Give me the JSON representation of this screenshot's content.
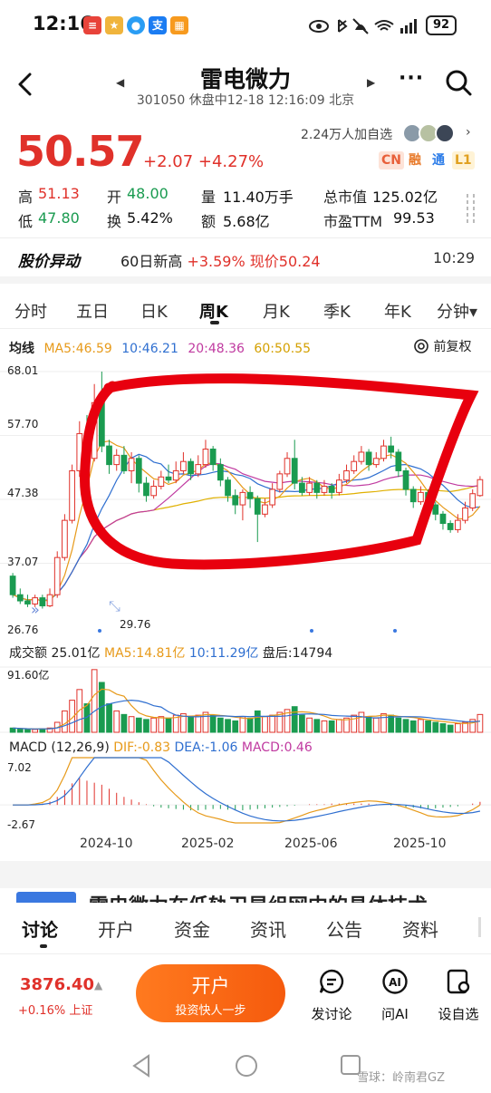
{
  "status": {
    "time": "12:16",
    "battery": "92",
    "colors": {
      "red": "#e8433a",
      "orange": "#f79a1e",
      "blue": "#1b7cf2"
    }
  },
  "header": {
    "stock_name": "雷电微力",
    "subtitle": "301050 休盘中12-18 12:16:09 北京"
  },
  "quote": {
    "price": "50.57",
    "change": "+2.07 +4.27%",
    "followers": "2.24万人加自选",
    "tags": [
      "CN",
      "融",
      "通",
      "L1"
    ],
    "stats": [
      {
        "label": "高",
        "value": "51.13",
        "color": "#e0312a"
      },
      {
        "label": "开",
        "value": "48.00",
        "color": "#1a9b50"
      },
      {
        "label": "量",
        "value": "11.40万手",
        "color": "#222"
      },
      {
        "label": "总市值",
        "value": "125.02亿",
        "color": "#222"
      },
      {
        "label": "低",
        "value": "47.80",
        "color": "#1a9b50"
      },
      {
        "label": "换",
        "value": "5.42%",
        "color": "#222"
      },
      {
        "label": "额",
        "value": "5.68亿",
        "color": "#222"
      },
      {
        "label": "市盈TTM",
        "value": "99.53",
        "color": "#222"
      }
    ]
  },
  "alert": {
    "title": "股价异动",
    "text_prefix": "60日新高 ",
    "text_highlight": "+3.59%",
    "text_suffix": " 现价50.24",
    "time": "10:29"
  },
  "period_tabs": [
    "分时",
    "五日",
    "日K",
    "周K",
    "月K",
    "季K",
    "年K",
    "分钟▾"
  ],
  "active_period": "周K",
  "ma": {
    "title": "均线",
    "ma5": "MA5:46.59",
    "ma10": "10:46.21",
    "ma20": "20:48.36",
    "ma60": "60:50.55",
    "adjust": "前复权"
  },
  "price_axis": [
    "68.01",
    "57.70",
    "47.38",
    "37.07",
    "26.76"
  ],
  "min_marker": "29.76",
  "volume": {
    "title": "成交额",
    "value": "25.01亿",
    "ma5": "MA5:14.81亿",
    "ma10": "10:11.29亿",
    "extra": "盘后:14794",
    "axis_max": "91.60亿"
  },
  "macd": {
    "title": "MACD",
    "params": "(12,26,9)",
    "dif": "DIF:-0.83",
    "dea": "DEA:-1.06",
    "macd": "MACD:0.46",
    "axis_max": "7.02",
    "axis_min": "-2.67"
  },
  "x_dates": [
    "2024-10",
    "2025-02",
    "2025-06",
    "2025-10"
  ],
  "news_peek": "雷电微力在低轨卫星组网中的具体技术",
  "bottom_tabs": [
    "讨论",
    "开户",
    "资金",
    "资讯",
    "公告",
    "资料"
  ],
  "footer": {
    "index_value": "3876.40",
    "index_change": "+0.16% 上证",
    "open_main": "开户",
    "open_sub": "投资快人一步",
    "buttons": [
      "发讨论",
      "问AI",
      "设自选"
    ]
  },
  "watermark": "雪球：岭南君GZ",
  "chart_data": {
    "type": "candlestick",
    "period": "weekly",
    "x_labels": [
      "2024-10",
      "2025-02",
      "2025-06",
      "2025-10"
    ],
    "ylim": [
      26.76,
      68.01
    ],
    "candles": [
      [
        35.0,
        32.0,
        35.5,
        31.5
      ],
      [
        32.0,
        31.0,
        33.0,
        30.5
      ],
      [
        31.0,
        30.5,
        32.0,
        30.0
      ],
      [
        30.5,
        31.5,
        32.0,
        30.0
      ],
      [
        31.5,
        30.2,
        32.0,
        29.76
      ],
      [
        30.2,
        32.0,
        33.0,
        30.0
      ],
      [
        32.0,
        38.0,
        39.0,
        31.5
      ],
      [
        38.0,
        44.0,
        45.0,
        37.5
      ],
      [
        44.0,
        52.0,
        53.0,
        43.5
      ],
      [
        52.0,
        58.0,
        60.0,
        51.0
      ],
      [
        58.0,
        54.0,
        61.0,
        53.0
      ],
      [
        54.0,
        63.0,
        66.0,
        53.5
      ],
      [
        63.0,
        56.0,
        68.01,
        55.0
      ],
      [
        56.0,
        53.0,
        57.0,
        51.5
      ],
      [
        53.0,
        54.5,
        55.5,
        52.0
      ],
      [
        54.5,
        52.0,
        56.0,
        51.5
      ],
      [
        52.0,
        54.0,
        55.0,
        50.0
      ],
      [
        54.0,
        50.0,
        54.5,
        48.5
      ],
      [
        50.0,
        48.0,
        51.0,
        47.0
      ],
      [
        48.0,
        49.5,
        50.5,
        47.5
      ],
      [
        49.5,
        51.0,
        52.0,
        49.0
      ],
      [
        51.0,
        50.5,
        53.0,
        50.0
      ],
      [
        50.5,
        52.0,
        53.5,
        50.0
      ],
      [
        52.0,
        53.5,
        55.0,
        51.5
      ],
      [
        53.5,
        51.5,
        54.0,
        50.5
      ],
      [
        51.5,
        53.0,
        54.5,
        51.0
      ],
      [
        53.0,
        55.5,
        57.0,
        52.5
      ],
      [
        55.5,
        53.0,
        56.0,
        52.0
      ],
      [
        53.0,
        50.5,
        54.0,
        49.5
      ],
      [
        50.5,
        48.0,
        51.0,
        47.0
      ],
      [
        48.0,
        46.5,
        49.0,
        45.0
      ],
      [
        46.5,
        48.5,
        49.0,
        44.0
      ],
      [
        48.5,
        47.5,
        49.5,
        46.0
      ],
      [
        47.5,
        45.0,
        48.0,
        40.5
      ],
      [
        45.0,
        46.5,
        47.5,
        44.5
      ],
      [
        46.5,
        49.0,
        50.0,
        46.0
      ],
      [
        49.0,
        51.5,
        52.0,
        48.5
      ],
      [
        51.5,
        54.0,
        55.0,
        51.0
      ],
      [
        54.0,
        50.0,
        57.0,
        49.0
      ],
      [
        50.0,
        48.5,
        51.0,
        48.0
      ],
      [
        48.5,
        50.0,
        51.0,
        48.0
      ],
      [
        50.0,
        48.5,
        50.5,
        47.5
      ],
      [
        48.5,
        49.5,
        50.5,
        48.0
      ],
      [
        49.5,
        48.5,
        50.0,
        47.5
      ],
      [
        48.5,
        50.5,
        51.5,
        48.0
      ],
      [
        50.5,
        52.0,
        53.0,
        50.0
      ],
      [
        52.0,
        53.5,
        54.5,
        51.5
      ],
      [
        53.5,
        55.0,
        56.0,
        53.0
      ],
      [
        55.0,
        53.0,
        55.5,
        52.0
      ],
      [
        53.0,
        54.0,
        55.0,
        52.5
      ],
      [
        54.0,
        56.0,
        57.0,
        53.5
      ],
      [
        56.0,
        55.0,
        57.5,
        54.0
      ],
      [
        55.0,
        52.0,
        55.5,
        51.0
      ],
      [
        52.0,
        49.0,
        52.5,
        48.0
      ],
      [
        49.0,
        47.0,
        49.5,
        46.0
      ],
      [
        47.0,
        48.5,
        49.5,
        46.5
      ],
      [
        48.5,
        46.5,
        49.0,
        45.5
      ],
      [
        46.5,
        45.0,
        47.0,
        44.0
      ],
      [
        45.0,
        43.5,
        45.5,
        42.5
      ],
      [
        43.5,
        42.5,
        44.0,
        42.0
      ],
      [
        42.5,
        44.0,
        45.0,
        42.0
      ],
      [
        44.0,
        46.0,
        47.0,
        43.5
      ],
      [
        46.0,
        48.3,
        49.0,
        45.5
      ],
      [
        48.0,
        50.57,
        51.13,
        47.8
      ]
    ],
    "volume_max_yi": 91.6,
    "volume_yi": [
      6,
      5,
      4,
      4,
      5,
      6,
      14,
      30,
      45,
      60,
      40,
      88,
      70,
      40,
      30,
      25,
      22,
      20,
      18,
      20,
      22,
      20,
      24,
      26,
      22,
      24,
      28,
      24,
      20,
      18,
      16,
      22,
      20,
      30,
      22,
      24,
      28,
      32,
      36,
      24,
      20,
      18,
      16,
      16,
      18,
      20,
      24,
      28,
      22,
      20,
      26,
      24,
      20,
      18,
      16,
      18,
      16,
      14,
      12,
      10,
      12,
      14,
      18,
      25
    ],
    "macd_range": [
      -2.67,
      7.02
    ],
    "macd_hist": [
      0,
      0,
      0,
      0.1,
      0.2,
      0.5,
      1.2,
      2.2,
      3.2,
      4.0,
      3.6,
      3.3,
      3.0,
      2.4,
      1.8,
      1.2,
      0.8,
      0.4,
      0.1,
      -0.2,
      -0.4,
      -0.5,
      -0.6,
      -0.7,
      -0.8,
      -0.8,
      -0.7,
      -0.6,
      -0.6,
      -0.7,
      -0.8,
      -0.8,
      -0.7,
      -0.6,
      -0.5,
      -0.4,
      -0.3,
      -0.2,
      -0.1,
      0,
      0.1,
      0.1,
      0.1,
      0.2,
      0.2,
      0.2,
      0.2,
      0.2,
      0.2,
      0.1,
      0,
      -0.1,
      -0.2,
      -0.3,
      -0.4,
      -0.5,
      -0.6,
      -0.5,
      -0.4,
      -0.3,
      -0.2,
      0,
      0.2,
      0.46
    ]
  }
}
